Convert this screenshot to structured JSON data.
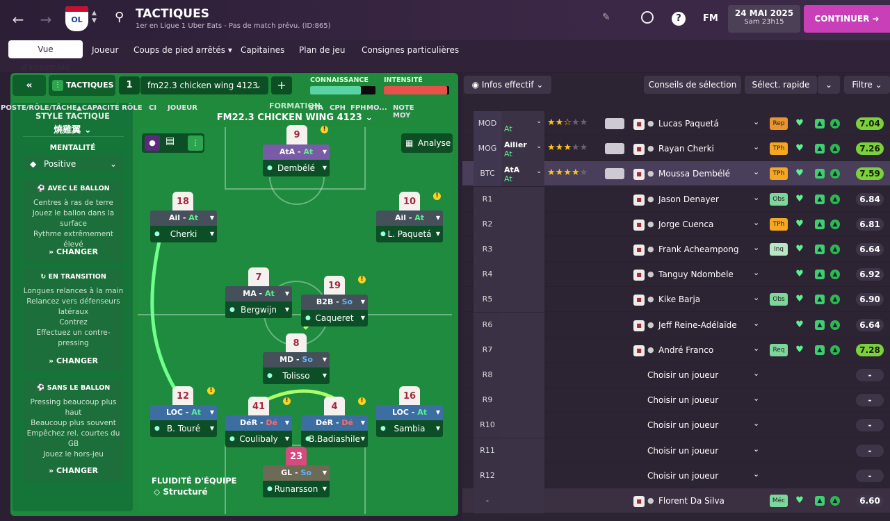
{
  "header": {
    "title": "TACTIQUES",
    "subtitle": "1er en Ligue 1 Uber Eats - Pas de match prévu. (ID:865)",
    "date": "24 MAI 2025",
    "time": "Sam 23h15",
    "fm_label": "FM",
    "continue_label": "CONTINUER"
  },
  "tabs": [
    "Vue d'ensemble",
    "Joueur",
    "Coups de pied arrêtés",
    "Capitaines",
    "Plan de jeu",
    "Consignes particulières"
  ],
  "tactics_bar": {
    "label": "TACTIQUES",
    "slot": "1",
    "tactic_name": "fm22.3 chicken wing 4123",
    "knowledge_label": "CONNAISSANCE",
    "intensity_label": "INTENSITÉ",
    "knowledge_level": 0.78,
    "intensity_level": 0.97
  },
  "style": {
    "title": "STYLE TACTIQUE",
    "value": "燒雞翼",
    "mentality_label": "MENTALITÉ",
    "mentality_value": "Positive",
    "in_possession": {
      "title": "AVEC LE BALLON",
      "lines": [
        "Centres à ras de terre",
        "Jouez le ballon dans la surface",
        "Rythme extrêmement élevé"
      ]
    },
    "transition": {
      "title": "EN TRANSITION",
      "lines": [
        "Longues relances à la main",
        "Relancez vers défenseurs latéraux",
        "Contrez",
        "Effectuez un contre-pressing"
      ]
    },
    "out_possession": {
      "title": "SANS LE BALLON",
      "lines": [
        "Pressing beaucoup plus haut",
        "Beaucoup plus souvent",
        "Empêchez rel. courtes du GB",
        "Jouez le hors-jeu"
      ]
    },
    "change_label": "CHANGER",
    "fluidity_label": "FLUIDITÉ D'ÉQUIPE",
    "fluidity_value": "Structuré"
  },
  "formation": {
    "label": "FORMATION",
    "name": "FM22.3 CHICKEN WING 4123",
    "analysis_label": "Analyse",
    "players": [
      {
        "num": "9",
        "role": "AtA",
        "duty": "At",
        "name": "Dembélé"
      },
      {
        "num": "18",
        "role": "Ail",
        "duty": "At",
        "name": "Cherki"
      },
      {
        "num": "10",
        "role": "Ail",
        "duty": "At",
        "name": "L. Paquetá"
      },
      {
        "num": "7",
        "role": "MA",
        "duty": "At",
        "name": "Bergwijn"
      },
      {
        "num": "19",
        "role": "B2B",
        "duty": "So",
        "name": "Caqueret"
      },
      {
        "num": "8",
        "role": "MD",
        "duty": "So",
        "name": "Tolisso"
      },
      {
        "num": "12",
        "role": "LOC",
        "duty": "At",
        "name": "B. Touré"
      },
      {
        "num": "41",
        "role": "DéR",
        "duty": "Dé",
        "name": "Coulibaly"
      },
      {
        "num": "4",
        "role": "DéR",
        "duty": "Dé",
        "name": "B.Badiashile"
      },
      {
        "num": "16",
        "role": "LOC",
        "duty": "At",
        "name": "Sambia"
      },
      {
        "num": "23",
        "role": "GL",
        "duty": "So",
        "name": "Runarsson"
      }
    ]
  },
  "squad": {
    "infos_label": "Infos effectif",
    "advice_label": "Conseils de sélection",
    "quick_label": "Sélect. rapide",
    "filter_label": "Filtre",
    "columns": [
      "POSTE/RÔLE/TÂCHE",
      "CAPACITÉ RÔLE",
      "CI",
      "JOUEUR",
      "STA",
      "CPH",
      "FPH",
      "MO...",
      "NOTE MOY"
    ],
    "rows": [
      {
        "pos": "MOD",
        "role": "",
        "duty": "At",
        "name": "Lucas Paquetá",
        "sta": "Rep",
        "note": "7.04",
        "stars": 2.5
      },
      {
        "pos": "MOG",
        "role": "Ailier",
        "duty": "At",
        "name": "Rayan Cherki",
        "sta": "TPh",
        "note": "7.26",
        "stars": 3
      },
      {
        "pos": "BTC",
        "role": "AtA",
        "duty": "At",
        "name": "Moussa Dembélé",
        "sta": "TPh",
        "note": "7.59",
        "stars": 4
      },
      {
        "pos": "R1",
        "name": "Jason Denayer",
        "sta": "Obs",
        "note": "6.84"
      },
      {
        "pos": "R2",
        "name": "Jorge Cuenca",
        "sta": "TPh",
        "note": "6.81"
      },
      {
        "pos": "R3",
        "name": "Frank Acheampong",
        "sta": "Inq",
        "note": "6.64"
      },
      {
        "pos": "R4",
        "name": "Tanguy Ndombele",
        "sta": "",
        "note": "6.92"
      },
      {
        "pos": "R5",
        "name": "Kike Barja",
        "sta": "Obs",
        "note": "6.90"
      },
      {
        "pos": "R6",
        "name": "Jeff Reine-Adélaïde",
        "sta": "",
        "note": "6.64"
      },
      {
        "pos": "R7",
        "name": "André Franco",
        "sta": "Req",
        "note": "7.28"
      },
      {
        "pos": "R8",
        "name": "Choisir un joueur",
        "sta": "",
        "note": "-"
      },
      {
        "pos": "R9",
        "name": "Choisir un joueur",
        "sta": "",
        "note": "-"
      },
      {
        "pos": "R10",
        "name": "Choisir un joueur",
        "sta": "",
        "note": "-"
      },
      {
        "pos": "R11",
        "name": "Choisir un joueur",
        "sta": "",
        "note": "-"
      },
      {
        "pos": "R12",
        "name": "Choisir un joueur",
        "sta": "",
        "note": "-"
      },
      {
        "pos": "-",
        "name": "Florent Da Silva",
        "sta": "Méc",
        "note": "6.60"
      }
    ]
  }
}
